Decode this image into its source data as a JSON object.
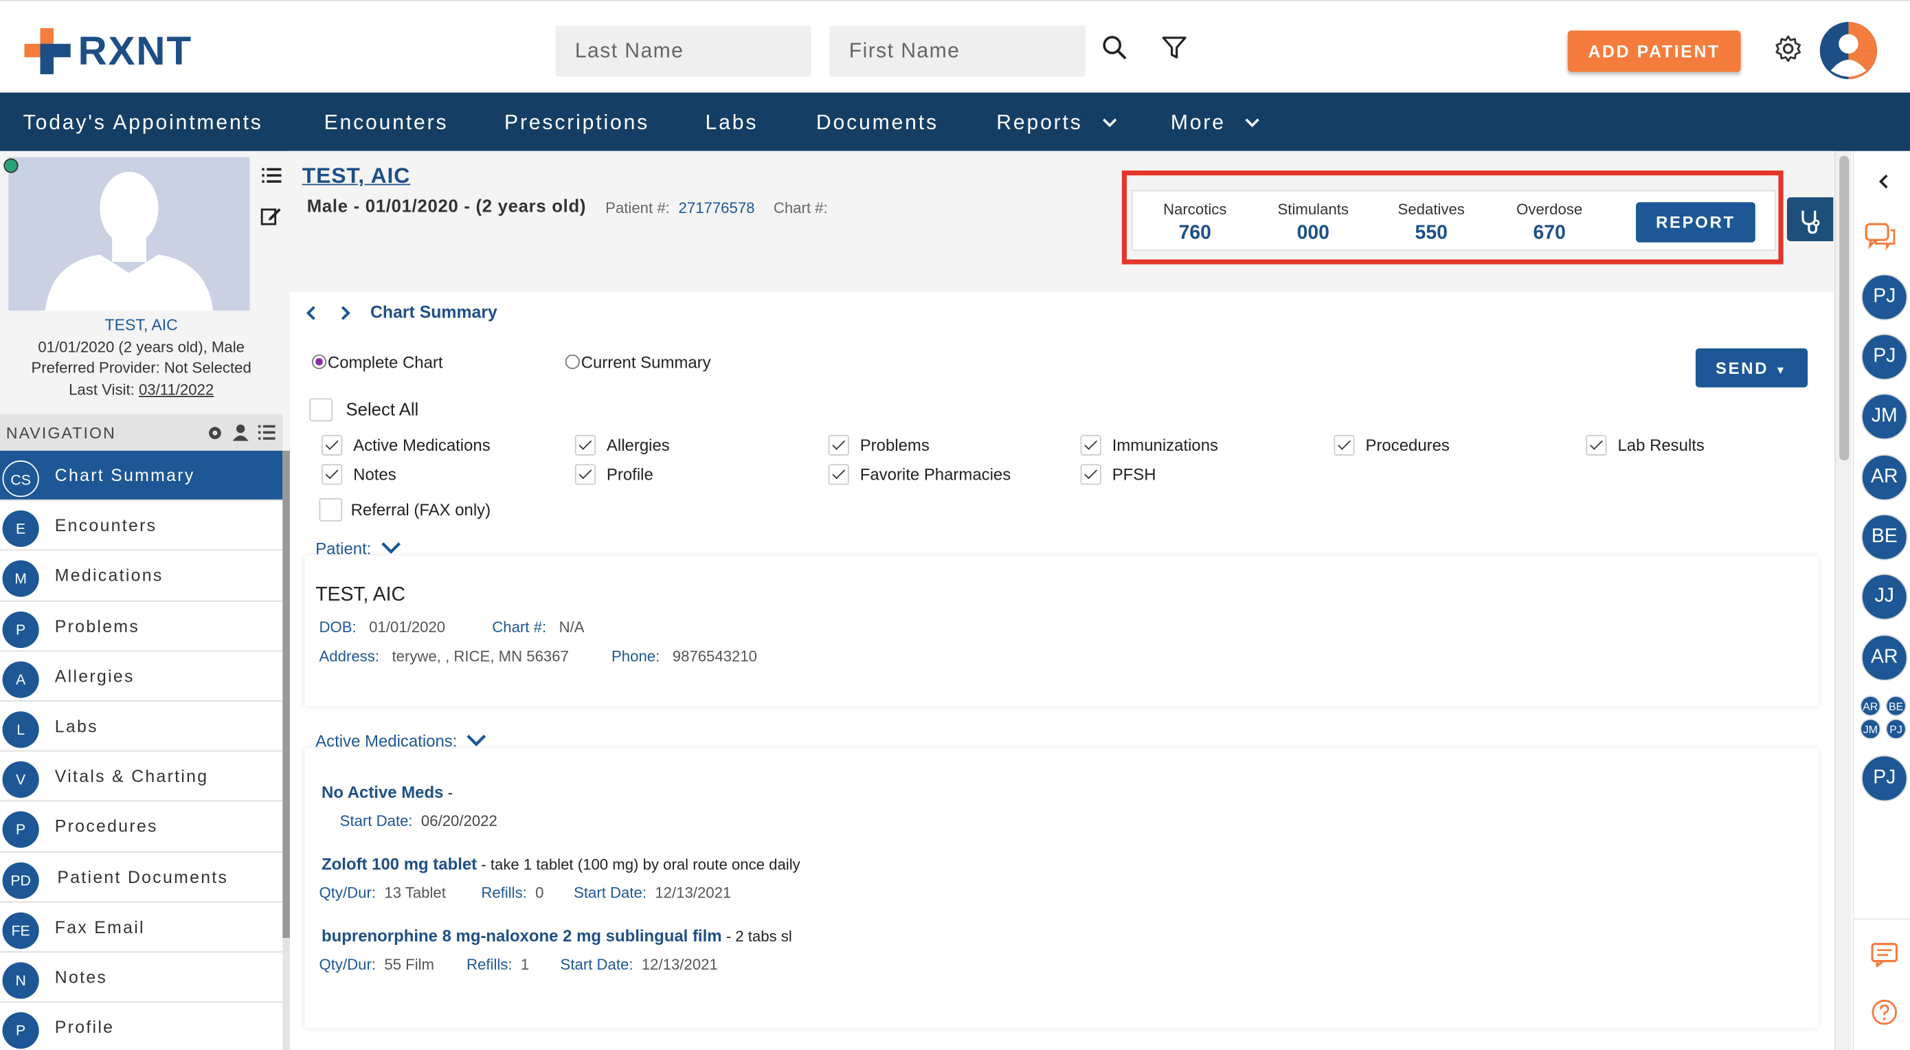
{
  "app": {
    "logo_text": "RXNT",
    "search": {
      "last_name_placeholder": "Last Name",
      "first_name_placeholder": "First Name"
    },
    "add_patient_label": "ADD PATIENT"
  },
  "nav": {
    "items": [
      {
        "label": "Today's Appointments"
      },
      {
        "label": "Encounters"
      },
      {
        "label": "Prescriptions"
      },
      {
        "label": "Labs"
      },
      {
        "label": "Documents"
      },
      {
        "label": "Reports"
      },
      {
        "label": "More"
      }
    ]
  },
  "patient_card": {
    "name": "TEST, AIC",
    "dob_line": "01/01/2020 (2 years old), Male",
    "provider_line": "Preferred Provider: Not Selected",
    "last_visit_label": "Last Visit:",
    "last_visit_value": "03/11/2022"
  },
  "sidebar": {
    "heading": "NAVIGATION",
    "items": [
      {
        "badge": "CS",
        "label": "Chart Summary"
      },
      {
        "badge": "E",
        "label": "Encounters"
      },
      {
        "badge": "M",
        "label": "Medications"
      },
      {
        "badge": "P",
        "label": "Problems"
      },
      {
        "badge": "A",
        "label": "Allergies"
      },
      {
        "badge": "L",
        "label": "Labs"
      },
      {
        "badge": "V",
        "label": "Vitals & Charting"
      },
      {
        "badge": "P",
        "label": "Procedures"
      },
      {
        "badge": "PD",
        "label": "Patient Documents"
      },
      {
        "badge": "FE",
        "label": "Fax Email"
      },
      {
        "badge": "N",
        "label": "Notes"
      },
      {
        "badge": "P",
        "label": "Profile"
      }
    ]
  },
  "header_patient": {
    "name": "TEST, AIC",
    "demo": "Male - 01/01/2020 - (2 years old)",
    "patient_num_label": "Patient #:",
    "patient_num": "271776578",
    "chart_num_label": "Chart #:"
  },
  "pdmp": {
    "metrics": [
      {
        "label": "Narcotics",
        "value": "760"
      },
      {
        "label": "Stimulants",
        "value": "000"
      },
      {
        "label": "Sedatives",
        "value": "550"
      },
      {
        "label": "Overdose",
        "value": "670"
      }
    ],
    "report_label": "REPORT"
  },
  "chart": {
    "breadcrumb": "Chart Summary",
    "radio_complete": "Complete Chart",
    "radio_current": "Current Summary",
    "send_label": "SEND",
    "select_all": "Select All",
    "checkboxes_row1": [
      "Active Medications",
      "Allergies",
      "Problems",
      "Immunizations",
      "Procedures",
      "Lab Results"
    ],
    "checkboxes_row2": [
      "Notes",
      "Profile",
      "Favorite Pharmacies",
      "PFSH"
    ],
    "referral": "Referral (FAX only)"
  },
  "patient_section": {
    "title": "Patient:",
    "name": "TEST, AIC",
    "dob_label": "DOB:",
    "dob": "01/01/2020",
    "chart_label": "Chart #:",
    "chart": "N/A",
    "address_label": "Address:",
    "address": "terywe, , RICE, MN 56367",
    "phone_label": "Phone:",
    "phone": "9876543210"
  },
  "meds_section": {
    "title": "Active Medications:",
    "meds": [
      {
        "name": "No Active Meds",
        "desc": " -",
        "start_label": "Start Date:",
        "start": "06/20/2022"
      },
      {
        "name": "Zoloft 100 mg tablet",
        "desc": " - take 1 tablet (100 mg) by oral route once daily",
        "qty_label": "Qty/Dur:",
        "qty": "13 Tablet",
        "refills_label": "Refills:",
        "refills": "0",
        "start_label": "Start Date:",
        "start": "12/13/2021"
      },
      {
        "name": "buprenorphine 8 mg-naloxone 2 mg sublingual film",
        "desc": " - 2 tabs sl",
        "qty_label": "Qty/Dur:",
        "qty": "55 Film",
        "refills_label": "Refills:",
        "refills": "1",
        "start_label": "Start Date:",
        "start": "12/13/2021"
      }
    ]
  },
  "right_sidebar": {
    "avatars": [
      "PJ",
      "PJ",
      "JM",
      "AR",
      "BE",
      "JJ",
      "AR"
    ],
    "mini": [
      "AR",
      "BE",
      "JM",
      "PJ"
    ],
    "last": "PJ"
  },
  "colors": {
    "brand_navy": "#153e64",
    "accent_orange": "#f47c3c",
    "link_blue": "#1d5796",
    "highlight_red": "#e5352b"
  }
}
